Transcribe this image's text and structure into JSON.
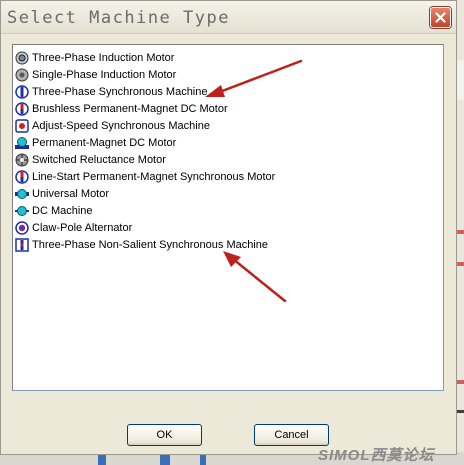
{
  "window": {
    "title": "Select Machine Type",
    "close_icon": "close-icon"
  },
  "machine_list": {
    "items": [
      {
        "label": "Three-Phase Induction Motor",
        "icon": "induction-motor-icon"
      },
      {
        "label": "Single-Phase Induction Motor",
        "icon": "single-phase-motor-icon"
      },
      {
        "label": "Three-Phase Synchronous Machine",
        "icon": "synchronous-machine-icon"
      },
      {
        "label": "Brushless Permanent-Magnet DC Motor",
        "icon": "brushless-dc-motor-icon"
      },
      {
        "label": "Adjust-Speed  Synchronous Machine",
        "icon": "adjust-speed-machine-icon"
      },
      {
        "label": "Permanent-Magnet DC Motor",
        "icon": "pm-dc-motor-icon"
      },
      {
        "label": "Switched Reluctance Motor",
        "icon": "reluctance-motor-icon"
      },
      {
        "label": "Line-Start Permanent-Magnet Synchronous Motor",
        "icon": "line-start-motor-icon"
      },
      {
        "label": "Universal Motor",
        "icon": "universal-motor-icon"
      },
      {
        "label": "DC Machine",
        "icon": "dc-machine-icon"
      },
      {
        "label": "Claw-Pole Alternator",
        "icon": "claw-pole-alternator-icon"
      },
      {
        "label": "Three-Phase Non-Salient Synchronous Machine",
        "icon": "non-salient-machine-icon"
      }
    ]
  },
  "annotations": {
    "arrow_color": "#c0201c"
  },
  "buttons": {
    "ok_label": "OK",
    "cancel_label": "Cancel"
  },
  "watermark": {
    "text": "SIMOL西莫论坛"
  }
}
